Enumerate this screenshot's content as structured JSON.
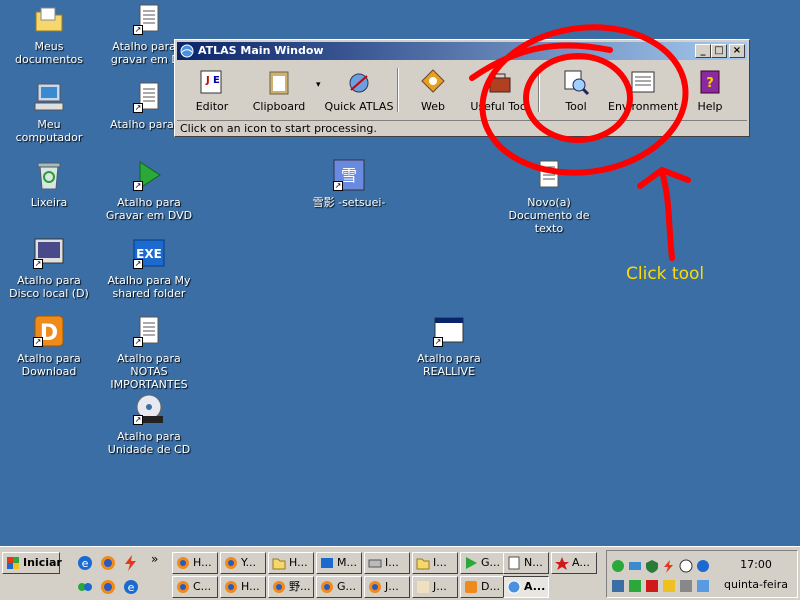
{
  "desktop": {
    "icons": [
      {
        "label": "Meus documentos"
      },
      {
        "label": "Meu computador"
      },
      {
        "label": "Lixeira"
      },
      {
        "label": "Atalho para Disco local (D)"
      },
      {
        "label": "Atalho para Download"
      },
      {
        "label": "Atalho para F gravar em DV"
      },
      {
        "label": "Atalho para fo"
      },
      {
        "label": "Atalho para Gravar em DVD"
      },
      {
        "label": "Atalho para My shared folder"
      },
      {
        "label": "Atalho para NOTAS IMPORTANTES"
      },
      {
        "label": "Atalho para Unidade de CD"
      },
      {
        "label": "雪影 -setsuei-"
      },
      {
        "label": "Novo(a) Documento de texto"
      },
      {
        "label": "Atalho para REALLIVE"
      }
    ]
  },
  "atlas_window": {
    "title": "ATLAS Main Window",
    "minimize": "_",
    "maximize": "□",
    "close": "×",
    "tools": [
      {
        "label": "Editor"
      },
      {
        "label": "Clipboard"
      },
      {
        "label": "Quick ATLAS"
      },
      {
        "label": "Web"
      },
      {
        "label": "Useful Tool"
      },
      {
        "label": "Tool"
      },
      {
        "label": "Environment"
      },
      {
        "label": "Help"
      }
    ],
    "clipboard_dropdown": "▾",
    "status": "Click on an icon to start processing."
  },
  "annotation": {
    "text": "Click tool",
    "color": "#ff0000"
  },
  "taskbar": {
    "start_label": "Iniciar",
    "ql_more": "»",
    "row1": [
      {
        "label": "H..."
      },
      {
        "label": "Y..."
      },
      {
        "label": "H..."
      },
      {
        "label": "M..."
      },
      {
        "label": "I..."
      },
      {
        "label": "I..."
      },
      {
        "label": "G..."
      },
      {
        "label": "N..."
      },
      {
        "label": "A..."
      }
    ],
    "row2": [
      {
        "label": "C..."
      },
      {
        "label": "H..."
      },
      {
        "label": "野..."
      },
      {
        "label": "G..."
      },
      {
        "label": "J..."
      },
      {
        "label": "J..."
      },
      {
        "label": "D..."
      },
      {
        "label": "A..."
      }
    ],
    "clock": {
      "time": "17:00",
      "day": "quinta-feira"
    }
  }
}
